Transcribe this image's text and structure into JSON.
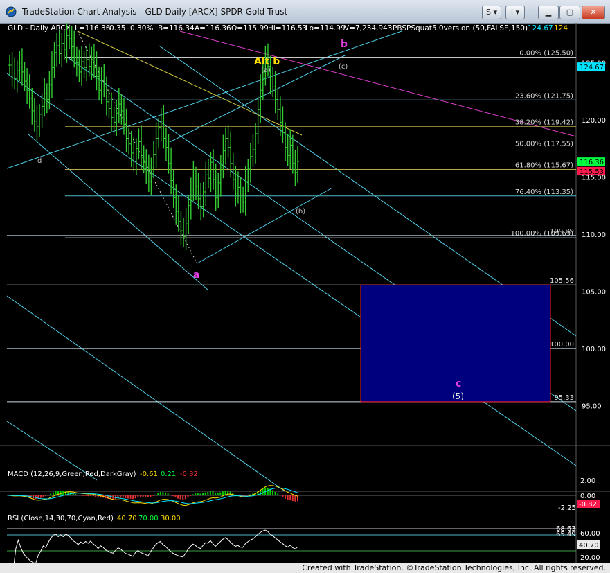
{
  "window": {
    "title": "TradeStation Chart Analysis - GLD Daily [ARCX] SPDR Gold Trust",
    "buttons": {
      "s": "S",
      "i": "I",
      "minimize": "▁",
      "maximize": "▢",
      "close": "✕"
    }
  },
  "symbol_header": {
    "symbol": "GLD - Daily  ARCX",
    "last": "L=116.36",
    "change": "0.35",
    "change_pct": "0.30%",
    "bid": "B=116.34",
    "ask": "A=116.36",
    "open": "O=115.99",
    "high": "Hi=116.53",
    "low": "Lo=114.99",
    "volume": "V=7,234,943",
    "study": "PBSPSquat5.0version (50,FALSE,150)",
    "study_v1": "124.67",
    "study_v2": "124"
  },
  "price_axis": {
    "ticks": [
      "125.00",
      "120.00",
      "115.00",
      "110.00",
      "105.00",
      "100.00",
      "95.00"
    ],
    "tick_values": [
      125,
      120,
      115,
      110,
      105,
      100,
      95
    ],
    "markers": [
      {
        "label": "124.67",
        "value": 124.67,
        "color": "#00e5ff"
      },
      {
        "label": "116.36",
        "value": 116.36,
        "color": "#00ff40"
      },
      {
        "label": "115.53",
        "value": 115.53,
        "color": "#ff1a4d"
      }
    ]
  },
  "fib_levels": [
    {
      "label": "0.00% (125.50)",
      "value": 125.5,
      "color": "#c8c8c8"
    },
    {
      "label": "23.60% (121.75)",
      "value": 121.75,
      "color": "#4fb8c8"
    },
    {
      "label": "38.20% (119.42)",
      "value": 119.42,
      "color": "#b8a84a"
    },
    {
      "label": "50.00% (117.55)",
      "value": 117.55,
      "color": "#c8c8c8"
    },
    {
      "label": "61.80% (115.67)",
      "value": 115.67,
      "color": "#b8a84a"
    },
    {
      "label": "76.40% (113.35)",
      "value": 113.35,
      "color": "#4fb8c8"
    },
    {
      "label": "100.00% (109.69)",
      "value": 109.69,
      "color": "#c8c8c8"
    }
  ],
  "hlines": [
    {
      "label": "109.89",
      "value": 109.89
    },
    {
      "label": "105.56",
      "value": 105.56
    },
    {
      "label": "100.00",
      "value": 100.0
    },
    {
      "label": "95.33",
      "value": 95.33
    }
  ],
  "target_box": {
    "top": 105.56,
    "bottom": 95.33,
    "fill": "#00007f",
    "border": "#ff2020"
  },
  "wave_labels": {
    "alt_b": "Alt b",
    "a_paren": "(a)",
    "b_paren": "(b)",
    "c_paren": "(c)",
    "b_magenta": "b",
    "a_magenta": "a",
    "d_small": "d",
    "c_magenta": "c",
    "five_paren": "(5)"
  },
  "macd": {
    "header": "MACD (12,26,9,Green,Red,DarkGray)",
    "v1": "-0.61",
    "v2": "0.21",
    "v3": "-0.82",
    "ticks": [
      "2.00",
      "0.00",
      "-2.25"
    ],
    "marker": "-0.82"
  },
  "rsi": {
    "header": "RSI (Close,14,30,70,Cyan,Red)",
    "v1": "40.70",
    "v2": "70.00",
    "v3": "30.00",
    "ticks": [
      "60.00",
      "40.70",
      "20.00"
    ],
    "levels": [
      "68.63",
      "65.49"
    ]
  },
  "chart_data": {
    "type": "candlestick",
    "title": "GLD Daily [ARCX] SPDR Gold Trust",
    "ylim": [
      91.5,
      128.5
    ],
    "closes": [
      124.8,
      124.1,
      123.6,
      124.3,
      124.9,
      124.2,
      123.4,
      122.6,
      121.9,
      120.8,
      119.9,
      119.4,
      120.5,
      121.2,
      122.3,
      121.8,
      123.1,
      124.6,
      125.9,
      126.5,
      125.8,
      126.7,
      126.2,
      127.4,
      127.1,
      126.4,
      125.5,
      125.0,
      124.2,
      125.1,
      124.6,
      125.3,
      124.7,
      125.5,
      124.6,
      123.8,
      122.6,
      123.5,
      122.9,
      121.6,
      121.0,
      120.2,
      119.8,
      120.6,
      121.4,
      120.8,
      119.6,
      118.4,
      117.9,
      117.1,
      116.4,
      117.5,
      118.1,
      116.9,
      116.3,
      115.6,
      114.6,
      115.8,
      117.0,
      118.4,
      119.3,
      119.9,
      118.4,
      117.6,
      116.2,
      114.7,
      113.2,
      112.0,
      111.1,
      110.3,
      109.8,
      110.9,
      112.5,
      113.8,
      115.0,
      114.2,
      113.1,
      112.4,
      113.7,
      115.2,
      114.9,
      116.3,
      114.8,
      113.2,
      114.5,
      115.8,
      117.3,
      118.4,
      117.6,
      116.2,
      114.8,
      113.6,
      114.1,
      113.0,
      112.8,
      114.6,
      115.7,
      116.8,
      117.4,
      118.8,
      120.9,
      122.6,
      124.2,
      125.3,
      124.7,
      123.5,
      122.9,
      121.8,
      120.9,
      119.8,
      118.9,
      117.6,
      116.9,
      117.8,
      116.2,
      115.4,
      116.36
    ],
    "macd_line_label": "-0.61",
    "rsi_value": 40.7
  }
}
